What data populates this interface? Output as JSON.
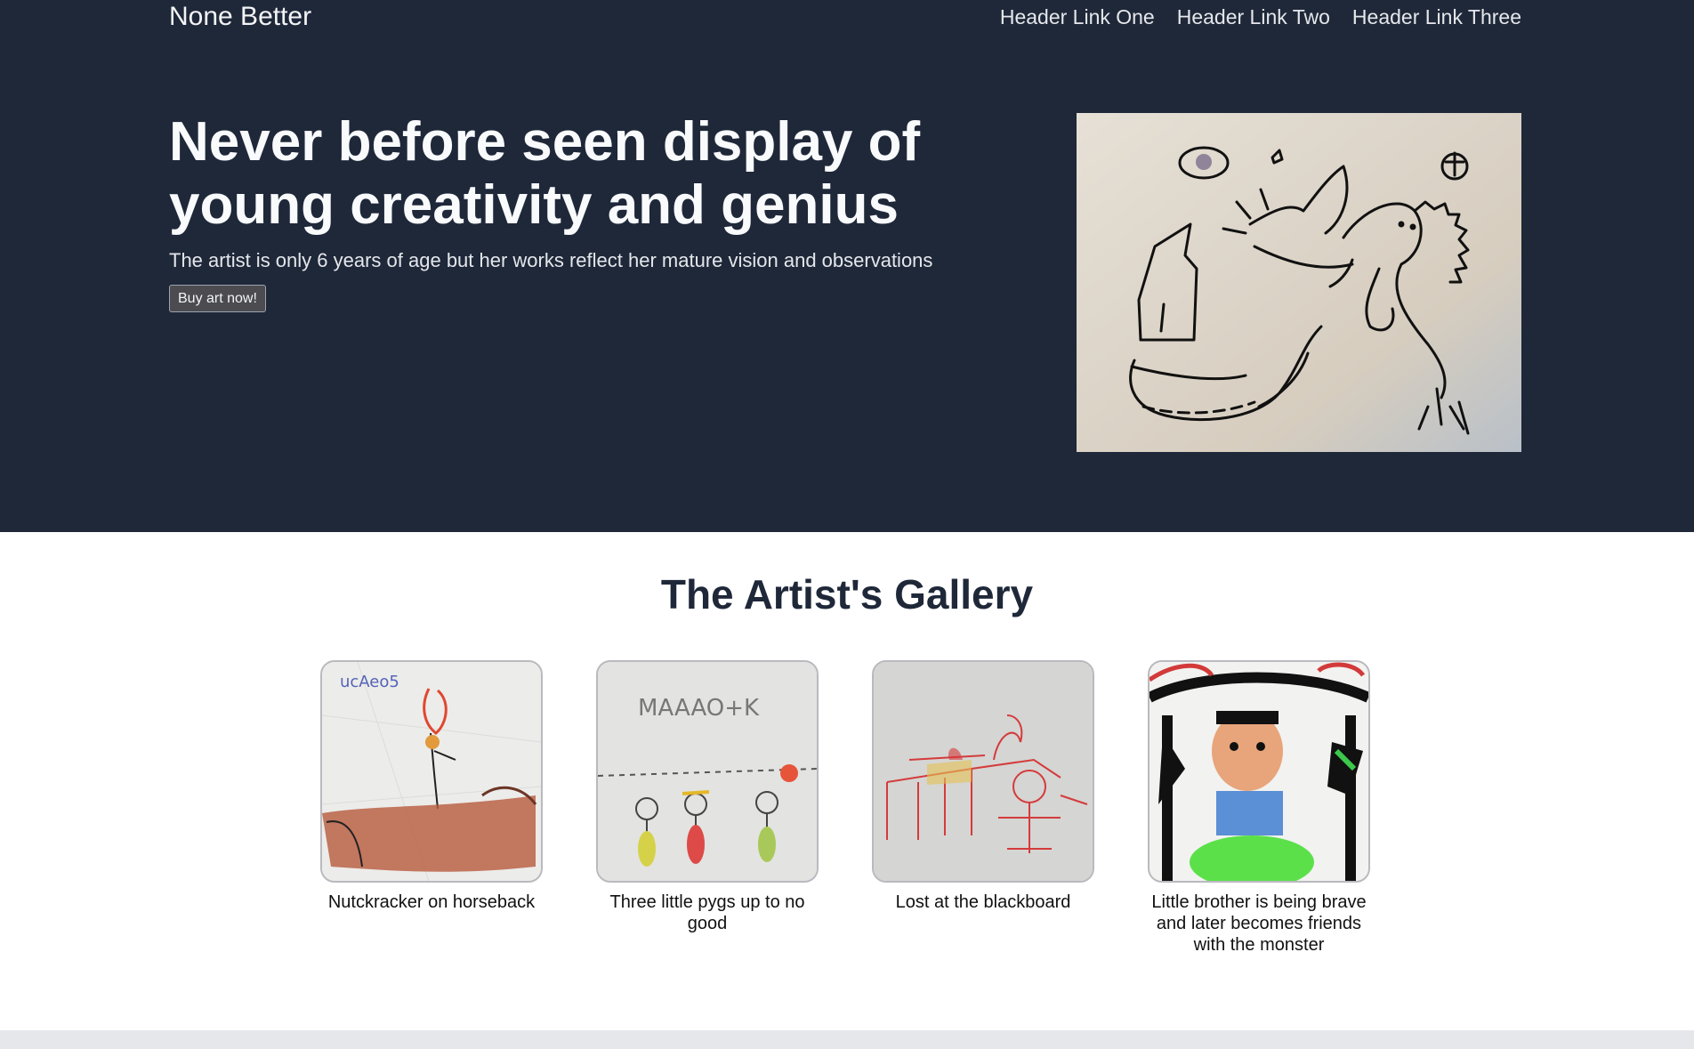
{
  "header": {
    "brand": "None Better",
    "links": [
      "Header Link One",
      "Header Link Two",
      "Header Link Three"
    ]
  },
  "hero": {
    "headline": "Never before seen display of young creativity and genius",
    "subtext": "The artist is only 6 years of age but her works reflect her mature vision and observations",
    "cta_label": "Buy art now!",
    "image_alt": "Child's drawing of a dragon"
  },
  "gallery": {
    "title": "The Artist's Gallery",
    "items": [
      {
        "caption": "Nutckracker on horseback"
      },
      {
        "caption": "Three little pygs up to no good"
      },
      {
        "caption": "Lost at the blackboard"
      },
      {
        "caption": "Little brother is being brave and later becomes friends with the monster"
      }
    ]
  },
  "colors": {
    "hero_bg": "#1f2839",
    "title_text": "#1f2839",
    "footer_strip": "#e5e7eb"
  }
}
